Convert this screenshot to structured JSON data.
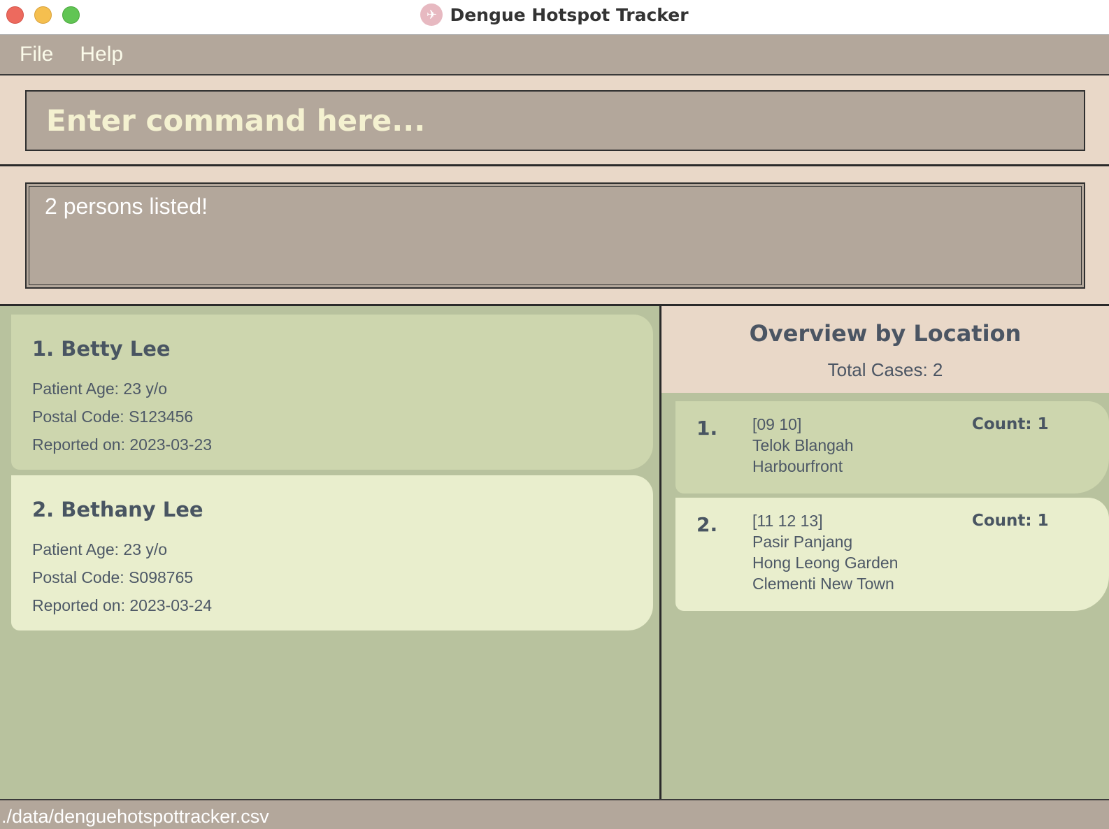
{
  "window": {
    "title": "Dengue Hotspot Tracker",
    "app_icon": "mosquito-icon"
  },
  "menu": {
    "items": [
      {
        "label": "File"
      },
      {
        "label": "Help"
      }
    ]
  },
  "command": {
    "placeholder": "Enter command here..."
  },
  "result": {
    "message": "2 persons listed!"
  },
  "persons": [
    {
      "name": "1. Betty Lee",
      "age": "Patient Age: 23 y/o",
      "postal": "Postal Code: S123456",
      "reported": "Reported on: 2023-03-23"
    },
    {
      "name": "2. Bethany Lee",
      "age": "Patient Age: 23 y/o",
      "postal": "Postal Code: S098765",
      "reported": "Reported on: 2023-03-24"
    }
  ],
  "overview": {
    "title": "Overview by Location",
    "total": "Total Cases: 2",
    "locations": [
      {
        "index": "1.",
        "lines": [
          "[09 10]",
          "Telok Blangah",
          "Harbourfront"
        ],
        "count": "Count: 1"
      },
      {
        "index": "2.",
        "lines": [
          "[11 12 13]",
          "Pasir Panjang",
          "Hong Leong Garden",
          "Clementi New Town"
        ],
        "count": "Count: 1"
      }
    ]
  },
  "status": {
    "path": "./data/denguehotspottracker.csv"
  },
  "colors": {
    "accent_beige": "#e9d8c8",
    "taupe": "#b3a79b",
    "sage": "#b8c29e",
    "card_dark": "#cdd6ae",
    "card_light": "#e9eecd"
  }
}
